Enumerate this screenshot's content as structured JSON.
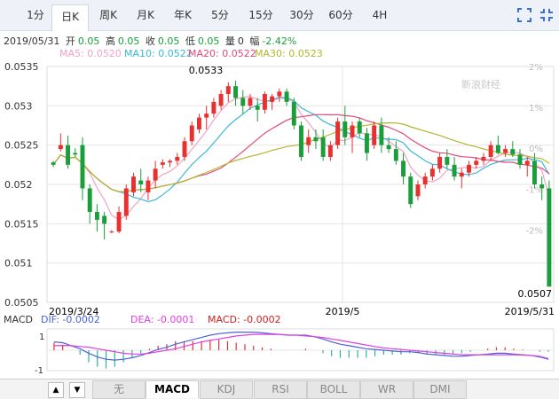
{
  "periods": [
    "1分",
    "日K",
    "周K",
    "月K",
    "年K",
    "5分",
    "15分",
    "30分",
    "60分",
    "4H"
  ],
  "active_period": "日K",
  "icons": {
    "fullscreen": "fullscreen-icon",
    "exit": "exit-fullscreen-icon"
  },
  "info": {
    "date": "2019/05/31",
    "open_label": "开",
    "open": "0.05",
    "high_label": "高",
    "high": "0.05",
    "close_label": "收",
    "close": "0.05",
    "low_label": "低",
    "low": "0.05",
    "vol_label": "量",
    "vol": "0",
    "chg_label": "幅",
    "chg": "-2.42%"
  },
  "ma": [
    {
      "label": "MA5: 0.0520",
      "color": "#f0a3c5"
    },
    {
      "label": "MA10: 0.0522",
      "color": "#3cb7d8"
    },
    {
      "label": "MA20: 0.0522",
      "color": "#e04a7a"
    },
    {
      "label": "MA30: 0.0523",
      "color": "#b3b62f"
    }
  ],
  "watermark": "新浪财经",
  "colors": {
    "up": "#e8312f",
    "down": "#1a9e3a",
    "grid": "#e6e6e6"
  },
  "chart_data": {
    "type": "candlestick",
    "ylim": [
      0.0505,
      0.0535
    ],
    "y_ticks": [
      "0.0535",
      "0.053",
      "0.0525",
      "0.052",
      "0.0515",
      "0.051",
      "0.0505"
    ],
    "pct_ticks": [
      "2%",
      "1%",
      "0%",
      "-1%",
      "-2%"
    ],
    "x_labels": [
      "2019/3/24",
      "2019/5",
      "2019/5/31"
    ],
    "max_label": "0.0533",
    "min_label": "0.0507",
    "candles": [
      [
        0.05228,
        0.0523,
        0.05222,
        0.05225
      ],
      [
        0.05245,
        0.05265,
        0.05242,
        0.0525
      ],
      [
        0.0525,
        0.05262,
        0.0522,
        0.05225
      ],
      [
        0.0524,
        0.05246,
        0.05235,
        0.05238
      ],
      [
        0.0525,
        0.0526,
        0.0518,
        0.05195
      ],
      [
        0.05195,
        0.052,
        0.0515,
        0.05165
      ],
      [
        0.05165,
        0.05175,
        0.0514,
        0.05155
      ],
      [
        0.0516,
        0.05165,
        0.0513,
        0.0515
      ],
      [
        0.0514,
        0.05142,
        0.05138,
        0.0514
      ],
      [
        0.0514,
        0.05172,
        0.05138,
        0.05165
      ],
      [
        0.0516,
        0.052,
        0.05155,
        0.05195
      ],
      [
        0.0519,
        0.05215,
        0.05185,
        0.0521
      ],
      [
        0.05205,
        0.0522,
        0.0519,
        0.052
      ],
      [
        0.0519,
        0.0521,
        0.0518,
        0.05205
      ],
      [
        0.05205,
        0.0523,
        0.05195,
        0.0522
      ],
      [
        0.05225,
        0.05232,
        0.0522,
        0.05228
      ],
      [
        0.05228,
        0.05232,
        0.05222,
        0.0523
      ],
      [
        0.0523,
        0.0524,
        0.05225,
        0.05235
      ],
      [
        0.05235,
        0.0526,
        0.0523,
        0.05255
      ],
      [
        0.05255,
        0.0528,
        0.0525,
        0.05275
      ],
      [
        0.0527,
        0.0529,
        0.05265,
        0.05285
      ],
      [
        0.05285,
        0.053,
        0.0527,
        0.0529
      ],
      [
        0.0529,
        0.0531,
        0.05285,
        0.05305
      ],
      [
        0.053,
        0.0532,
        0.05295,
        0.05315
      ],
      [
        0.05315,
        0.0533,
        0.05305,
        0.05325
      ],
      [
        0.05325,
        0.05332,
        0.053,
        0.0531
      ],
      [
        0.0531,
        0.0532,
        0.0529,
        0.053
      ],
      [
        0.053,
        0.05315,
        0.05295,
        0.0531
      ],
      [
        0.053,
        0.0531,
        0.0528,
        0.05295
      ],
      [
        0.05295,
        0.05318,
        0.0529,
        0.05315
      ],
      [
        0.05305,
        0.05315,
        0.05295,
        0.05312
      ],
      [
        0.05312,
        0.05322,
        0.05305,
        0.05318
      ],
      [
        0.05318,
        0.05322,
        0.053,
        0.05305
      ],
      [
        0.05305,
        0.0531,
        0.0527,
        0.05275
      ],
      [
        0.05275,
        0.0528,
        0.0523,
        0.05235
      ],
      [
        0.0525,
        0.0527,
        0.0524,
        0.0526
      ],
      [
        0.0526,
        0.0527,
        0.05245,
        0.05255
      ],
      [
        0.0526,
        0.0527,
        0.0523,
        0.05235
      ],
      [
        0.05235,
        0.05255,
        0.0523,
        0.0525
      ],
      [
        0.0525,
        0.05285,
        0.05245,
        0.0528
      ],
      [
        0.0528,
        0.053,
        0.0525,
        0.0526
      ],
      [
        0.0526,
        0.0528,
        0.0524,
        0.05275
      ],
      [
        0.0528,
        0.05285,
        0.0526,
        0.05265
      ],
      [
        0.05265,
        0.05272,
        0.0523,
        0.0524
      ],
      [
        0.0525,
        0.0528,
        0.05245,
        0.05275
      ],
      [
        0.05275,
        0.05285,
        0.0524,
        0.0525
      ],
      [
        0.0525,
        0.0526,
        0.0524,
        0.05245
      ],
      [
        0.05245,
        0.05255,
        0.05225,
        0.0523
      ],
      [
        0.0523,
        0.0524,
        0.052,
        0.0521
      ],
      [
        0.0521,
        0.05215,
        0.0517,
        0.05175
      ],
      [
        0.05185,
        0.05205,
        0.0518,
        0.052
      ],
      [
        0.052,
        0.05215,
        0.05195,
        0.0521
      ],
      [
        0.0521,
        0.05225,
        0.05205,
        0.0522
      ],
      [
        0.0522,
        0.0524,
        0.05215,
        0.05235
      ],
      [
        0.05235,
        0.05245,
        0.0522,
        0.05225
      ],
      [
        0.05225,
        0.05235,
        0.05205,
        0.0521
      ],
      [
        0.0521,
        0.0522,
        0.05195,
        0.05215
      ],
      [
        0.05215,
        0.0523,
        0.0521,
        0.05225
      ],
      [
        0.05225,
        0.05235,
        0.0522,
        0.0523
      ],
      [
        0.0523,
        0.0524,
        0.05225,
        0.05235
      ],
      [
        0.05235,
        0.05255,
        0.0523,
        0.0525
      ],
      [
        0.0525,
        0.05262,
        0.05238,
        0.0524
      ],
      [
        0.0524,
        0.0525,
        0.05235,
        0.05245
      ],
      [
        0.05245,
        0.05255,
        0.05235,
        0.05238
      ],
      [
        0.05238,
        0.05245,
        0.0522,
        0.05225
      ],
      [
        0.05225,
        0.05235,
        0.0521,
        0.0523
      ],
      [
        0.0523,
        0.0524,
        0.05195,
        0.052
      ],
      [
        0.052,
        0.0521,
        0.0518,
        0.05195
      ],
      [
        0.05195,
        0.05205,
        0.0513,
        0.0507
      ]
    ],
    "macd": {
      "y_ticks": [
        "1",
        "-1"
      ],
      "dif_label": "DIF: -0.0002",
      "dif_color": "#4a64d8",
      "dea_label": "DEA: -0.0001",
      "dea_color": "#e040e0",
      "macd_label": "MACD: -0.0002",
      "macd_color": "#cc2222",
      "dif": [
        0.55,
        0.5,
        0.3,
        0.1,
        -0.2,
        -0.45,
        -0.6,
        -0.65,
        -0.6,
        -0.5,
        -0.35,
        -0.15,
        0.05,
        0.2,
        0.4,
        0.55,
        0.7,
        0.85,
        1.0,
        1.1,
        1.15,
        1.2,
        1.2,
        1.2,
        1.15,
        1.1,
        1.05,
        1.0,
        1.0,
        1.0,
        0.9,
        0.75,
        0.55,
        0.4,
        0.3,
        0.2,
        0.1,
        0.05,
        0.0,
        -0.05,
        -0.1,
        -0.1,
        -0.15,
        -0.25,
        -0.3,
        -0.35,
        -0.4,
        -0.4,
        -0.35,
        -0.3,
        -0.25,
        -0.2,
        -0.2,
        -0.25,
        -0.3,
        -0.35,
        -0.45,
        -0.6
      ],
      "dea": [
        0.3,
        0.32,
        0.3,
        0.25,
        0.2,
        0.1,
        0.0,
        -0.1,
        -0.2,
        -0.25,
        -0.25,
        -0.2,
        -0.1,
        0.0,
        0.1,
        0.25,
        0.4,
        0.55,
        0.65,
        0.75,
        0.85,
        0.95,
        1.0,
        1.05,
        1.05,
        1.05,
        1.05,
        1.0,
        1.0,
        0.95,
        0.9,
        0.85,
        0.75,
        0.65,
        0.55,
        0.45,
        0.35,
        0.25,
        0.15,
        0.1,
        0.05,
        0.0,
        -0.05,
        -0.1,
        -0.15,
        -0.2,
        -0.25,
        -0.3,
        -0.3,
        -0.3,
        -0.3,
        -0.3,
        -0.3,
        -0.3,
        -0.32,
        -0.35,
        -0.4,
        -0.55
      ]
    }
  },
  "bottom_tabs": [
    "无",
    "MACD",
    "KDJ",
    "RSI",
    "BOLL",
    "WR",
    "DMI"
  ],
  "active_bottom": "MACD"
}
